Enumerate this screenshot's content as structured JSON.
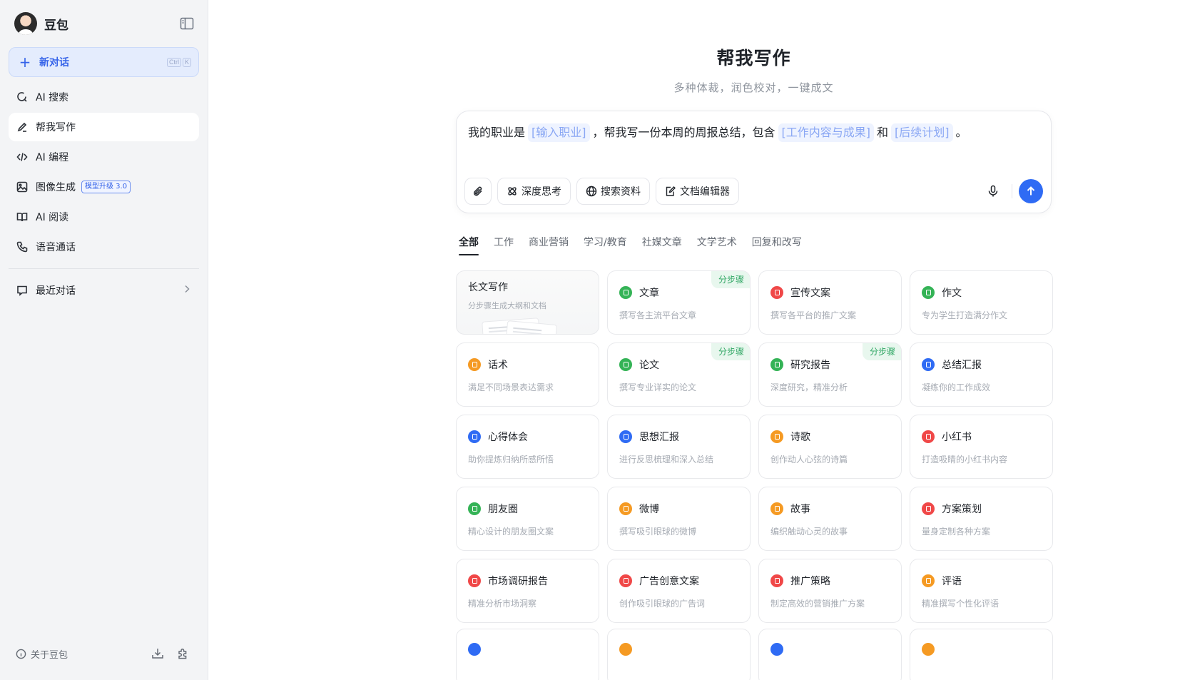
{
  "sidebar": {
    "brand": "豆包",
    "new_chat": {
      "label": "新对话",
      "shortcut": [
        "Ctrl",
        "K"
      ]
    },
    "items": [
      {
        "label": "AI 搜索",
        "icon": "search-refresh-icon"
      },
      {
        "label": "帮我写作",
        "icon": "pen-write-icon",
        "active": true
      },
      {
        "label": "AI 编程",
        "icon": "code-icon"
      },
      {
        "label": "图像生成",
        "icon": "image-icon",
        "badge": "模型升级 3.0"
      },
      {
        "label": "AI 阅读",
        "icon": "book-icon"
      },
      {
        "label": "语音通话",
        "icon": "phone-icon"
      }
    ],
    "recent": {
      "label": "最近对话"
    },
    "about": "关于豆包"
  },
  "main": {
    "title": "帮我写作",
    "subtitle": "多种体裁，润色校对，一键成文",
    "prompt": {
      "p1": "我的职业是",
      "slot1": "[输入职业]",
      "p2": "，帮我写一份本周的周报总结，包含",
      "slot2": "[工作内容与成果]",
      "p3": "和",
      "slot3": "[后续计划]",
      "p4": "。"
    },
    "tools": {
      "deep_think": "深度思考",
      "search": "搜索资料",
      "doc_editor": "文档编辑器"
    },
    "tabs": [
      "全部",
      "工作",
      "商业营销",
      "学习/教育",
      "社媒文章",
      "文学艺术",
      "回复和改写"
    ],
    "step_tag": "分步骤",
    "cards": [
      {
        "title": "长文写作",
        "desc": "分步骤生成大纲和文档",
        "color": "",
        "long": true
      },
      {
        "title": "文章",
        "desc": "撰写各主流平台文章",
        "color": "#34b356",
        "tag": true
      },
      {
        "title": "宣传文案",
        "desc": "撰写各平台的推广文案",
        "color": "#f04848"
      },
      {
        "title": "作文",
        "desc": "专为学生打造满分作文",
        "color": "#34b356"
      },
      {
        "title": "话术",
        "desc": "满足不同场景表达需求",
        "color": "#f59a23"
      },
      {
        "title": "论文",
        "desc": "撰写专业详实的论文",
        "color": "#34b356",
        "tag": true
      },
      {
        "title": "研究报告",
        "desc": "深度研究，精准分析",
        "color": "#34b356",
        "tag": true
      },
      {
        "title": "总结汇报",
        "desc": "凝练你的工作成效",
        "color": "#2f6bf4"
      },
      {
        "title": "心得体会",
        "desc": "助你提炼归纳所感所悟",
        "color": "#2f6bf4"
      },
      {
        "title": "思想汇报",
        "desc": "进行反思梳理和深入总结",
        "color": "#2f6bf4"
      },
      {
        "title": "诗歌",
        "desc": "创作动人心弦的诗篇",
        "color": "#f59a23"
      },
      {
        "title": "小红书",
        "desc": "打造吸睛的小红书内容",
        "color": "#f04848"
      },
      {
        "title": "朋友圈",
        "desc": "精心设计的朋友圈文案",
        "color": "#34b356"
      },
      {
        "title": "微博",
        "desc": "撰写吸引眼球的微博",
        "color": "#f59a23"
      },
      {
        "title": "故事",
        "desc": "编织触动心灵的故事",
        "color": "#f59a23"
      },
      {
        "title": "方案策划",
        "desc": "量身定制各种方案",
        "color": "#f04848"
      },
      {
        "title": "市场调研报告",
        "desc": "精准分析市场洞察",
        "color": "#f04848"
      },
      {
        "title": "广告创意文案",
        "desc": "创作吸引眼球的广告词",
        "color": "#f04848"
      },
      {
        "title": "推广策略",
        "desc": "制定高效的营销推广方案",
        "color": "#f04848"
      },
      {
        "title": "评语",
        "desc": "精准撰写个性化评语",
        "color": "#f59a23"
      }
    ],
    "partial_colors": [
      "#2f6bf4",
      "#f59a23",
      "#2f6bf4",
      "#f59a23"
    ]
  }
}
